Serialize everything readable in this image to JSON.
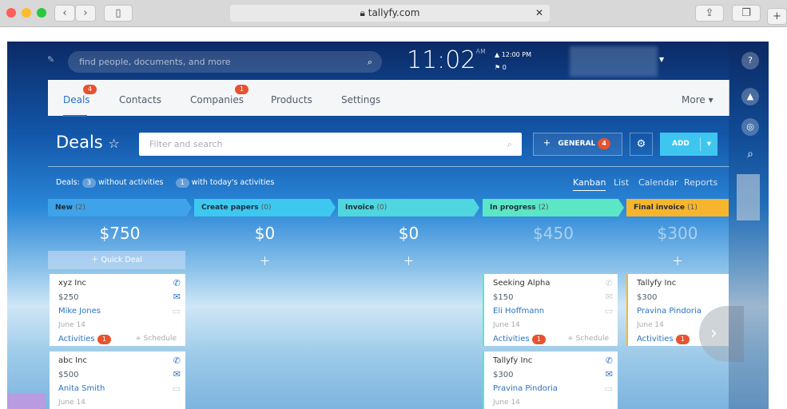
{
  "browser": {
    "url": "tallyfy.com"
  },
  "header": {
    "search_placeholder": "find people, documents, and more",
    "time": "11:02",
    "ampm": "AM",
    "alarm": "12:00 PM",
    "flags": "0"
  },
  "nav": {
    "tabs": [
      {
        "label": "Deals",
        "badge": "4"
      },
      {
        "label": "Contacts"
      },
      {
        "label": "Companies",
        "badge": "1"
      },
      {
        "label": "Products"
      },
      {
        "label": "Settings"
      }
    ],
    "more": "More"
  },
  "page": {
    "title": "Deals",
    "filter_placeholder": "Filter and search",
    "general_label": "GENERAL",
    "general_badge": "4",
    "add_label": "ADD",
    "summary_prefix": "Deals:",
    "without_count": "3",
    "without_label": "without activities",
    "today_count": "1",
    "today_label": "with today's activities",
    "views": [
      "Kanban",
      "List",
      "Calendar",
      "Reports"
    ]
  },
  "colors": {
    "new": "#3ea3e8",
    "create": "#3ec8f0",
    "invoice": "#4fd6de",
    "progress": "#5be6c6",
    "final": "#f7b52d",
    "badge": "#e8522e"
  },
  "columns": [
    {
      "name": "New",
      "count": "(2)",
      "total": "$750",
      "quick_deal": "Quick Deal"
    },
    {
      "name": "Create papers",
      "count": "(0)",
      "total": "$0"
    },
    {
      "name": "Invoice",
      "count": "(0)",
      "total": "$0"
    },
    {
      "name": "In progress",
      "count": "(2)",
      "total": "$450"
    },
    {
      "name": "Final invoice",
      "count": "(1)",
      "total": "$300"
    }
  ],
  "cards": [
    {
      "company": "xyz Inc",
      "amount": "$250",
      "contact": "Mike Jones",
      "date": "June 14",
      "activities": "Activities",
      "act_count": "1",
      "schedule": "+ Schedule"
    },
    {
      "company": "abc Inc",
      "amount": "$500",
      "contact": "Anita Smith",
      "date": "June 14"
    },
    {
      "company": "Seeking Alpha",
      "amount": "$150",
      "contact": "Eli Hoffmann",
      "date": "June 14",
      "activities": "Activities",
      "act_count": "1",
      "schedule": "+ Schedule"
    },
    {
      "company": "Tallyfy Inc",
      "amount": "$300",
      "contact": "Pravina Pindoria",
      "date": "June 14"
    },
    {
      "company": "Tallyfy Inc",
      "amount": "$300",
      "contact": "Pravina Pindoria",
      "date": "June 14",
      "activities": "Activities",
      "act_count": "1"
    }
  ]
}
